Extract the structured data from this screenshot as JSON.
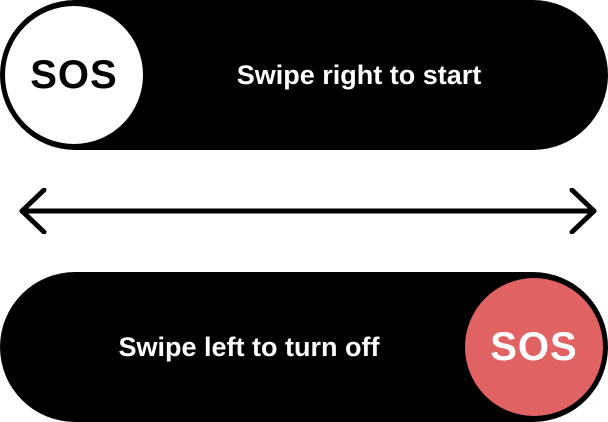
{
  "sos_start": {
    "knob_label": "SOS",
    "instruction": "Swipe right to start"
  },
  "sos_stop": {
    "knob_label": "SOS",
    "instruction": "Swipe left to turn off",
    "knob_color": "#e06262"
  },
  "divider": {
    "icon": "double-arrow-icon"
  },
  "colors": {
    "track": "#000000",
    "knob_idle": "#ffffff",
    "knob_active": "#e06262",
    "text_light": "#ffffff"
  }
}
